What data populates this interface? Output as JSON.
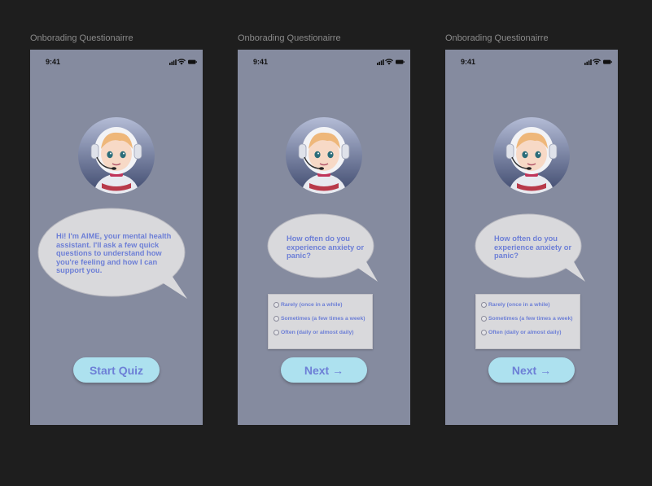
{
  "frames": [
    {
      "label": "Onborading Questionairre",
      "status_time": "9:41",
      "bubble_text": "Hi! I'm AIME, your mental health assistant. I'll ask a few quick questions to understand how you're feeling and how I can support you.",
      "button_label": "Start Quiz"
    },
    {
      "label": "Onborading Questionairre",
      "status_time": "9:41",
      "bubble_text": "How often do you experience anxiety or panic?",
      "options": [
        "Rarely (once in a while)",
        "Sometimes (a few times a week)",
        "Often (daily or almost daily)"
      ],
      "button_label": "Next →"
    },
    {
      "label": "Onborading Questionairre",
      "status_time": "9:41",
      "bubble_text": "How often do you experience anxiety or panic?",
      "options": [
        "Rarely (once in a while)",
        "Sometimes (a few times a week)",
        "Often (daily or almost daily)"
      ],
      "button_label": "Next →"
    }
  ],
  "icons": {
    "signal": "signal-bars-icon",
    "wifi": "wifi-icon",
    "battery": "battery-icon",
    "avatar": "robot-avatar"
  },
  "colors": {
    "canvas": "#1e1e1e",
    "frame_bg": "#858b9f",
    "bubble": "#d9d9dc",
    "accent_text": "#6d7fd6",
    "button": "#ade1ef"
  }
}
